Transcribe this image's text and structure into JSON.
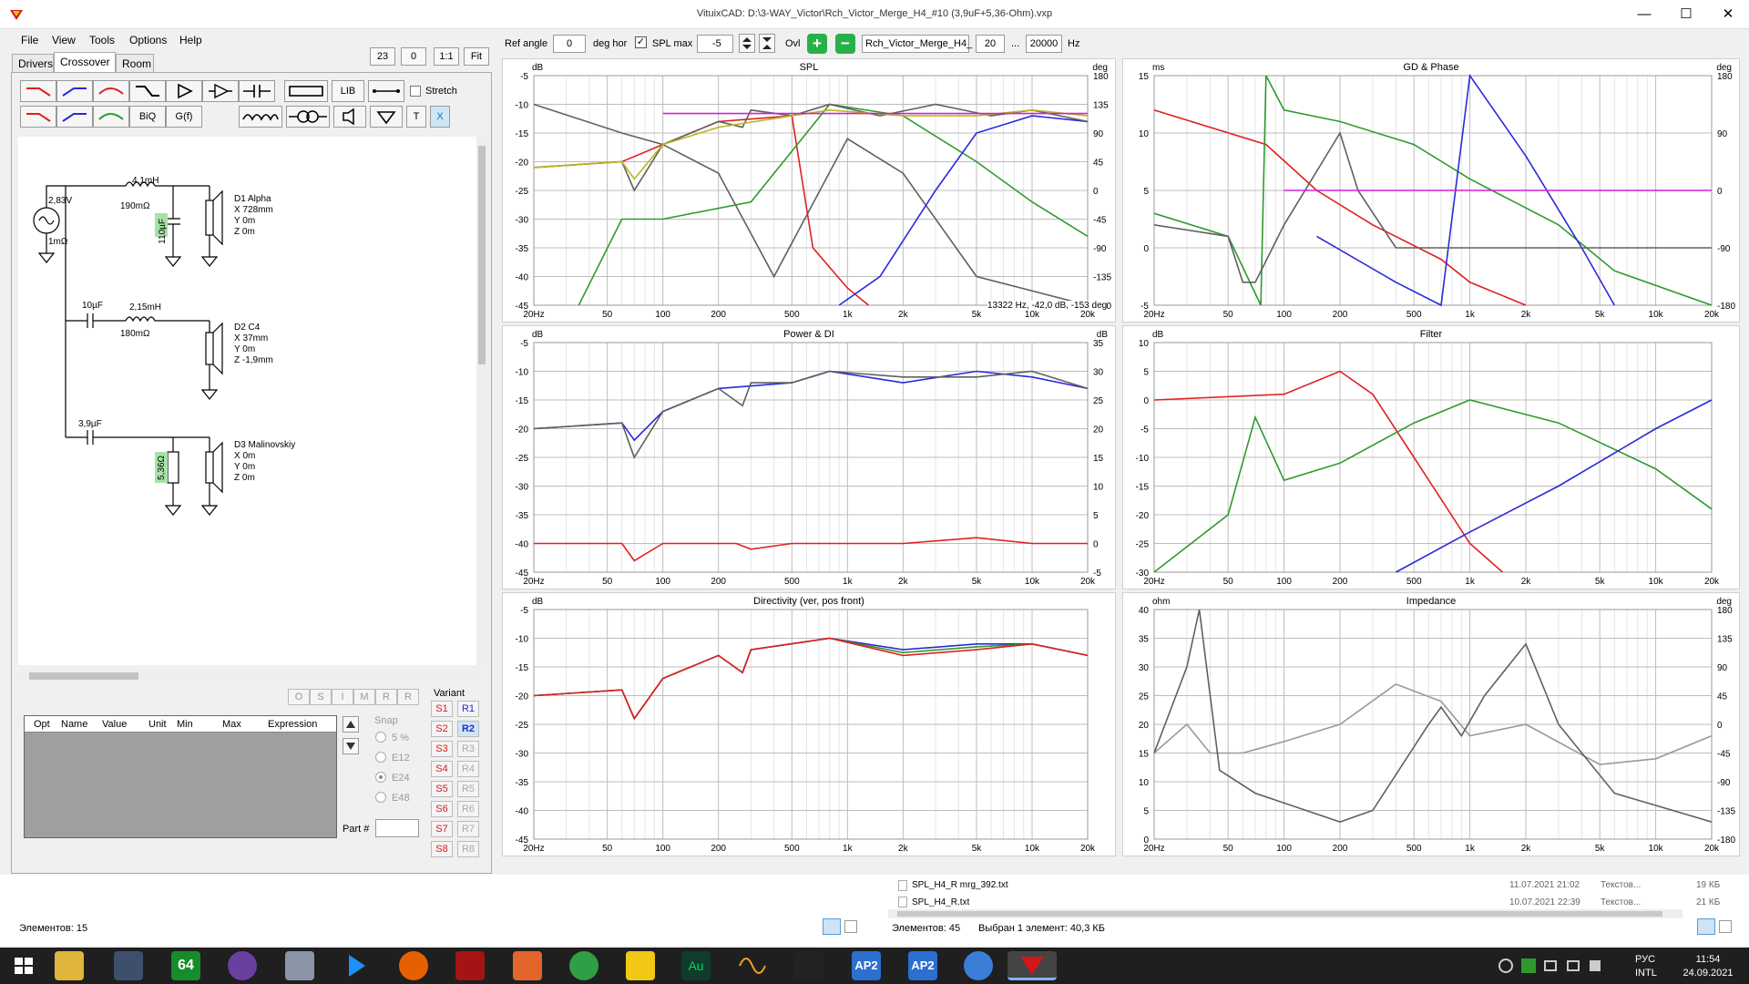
{
  "window": {
    "title": "VituixCAD: D:\\3-WAY_Victor\\Rch_Victor_Merge_H4_#10 (3,9uF+5,36-Ohm).vxp",
    "minimize": "—",
    "maximize": "☐",
    "close": "✕"
  },
  "menu": [
    "File",
    "View",
    "Tools",
    "Options",
    "Help"
  ],
  "tabs": [
    "Drivers",
    "Crossover",
    "Room"
  ],
  "zoom": {
    "a": "23",
    "b": "0",
    "c": "1:1",
    "d": "Fit"
  },
  "toolbar": {
    "lib": "LIB",
    "biq": "BiQ",
    "gf": "G(f)",
    "stretch": "Stretch",
    "t": "T",
    "x": "X"
  },
  "chart_toolbar": {
    "ref_angle_label": "Ref angle",
    "ref_angle_value": "0",
    "deg_hor": "deg hor",
    "spl_max_label": "SPL max",
    "spl_max_value": "-5",
    "ovl": "Ovl",
    "overlay_name": "Rch_Victor_Merge_H4_",
    "range_from": "20",
    "dots": "...",
    "range_to": "20000",
    "hz": "Hz"
  },
  "schematic": {
    "source_v": "2,83V",
    "source_r": "1mΩ",
    "l1": "4,1mH",
    "l1r": "190mΩ",
    "c1": "110µF",
    "d1": [
      "D1 Alpha",
      "X 728mm",
      "Y 0m",
      "Z 0m"
    ],
    "c2": "10µF",
    "l2": "2,15mH",
    "l2r": "180mΩ",
    "d2": [
      "D2 C4",
      "X 37mm",
      "Y 0m",
      "Z -1,9mm"
    ],
    "c3": "3,9µF",
    "r3": "5,36Ω",
    "d3": [
      "D3 Malinovskiy",
      "X 0m",
      "Y 0m",
      "Z 0m"
    ]
  },
  "part_table": {
    "headers": [
      "Opt",
      "Name",
      "Value",
      "Unit",
      "Min",
      "Max",
      "Expression"
    ],
    "osim": [
      "O",
      "S",
      "I",
      "M",
      "R",
      "R"
    ],
    "snap_label": "Snap",
    "snap_options": [
      "5 %",
      "E12",
      "E24",
      "E48"
    ],
    "snap_selected": "E24",
    "part_label": "Part #"
  },
  "variant": {
    "label": "Variant",
    "s": [
      "S1",
      "S2",
      "S3",
      "S4",
      "S5",
      "S6",
      "S7",
      "S8"
    ],
    "r": [
      "R1",
      "R2",
      "R3",
      "R4",
      "R5",
      "R6",
      "R7",
      "R8"
    ],
    "active_s": [
      "S1",
      "S2",
      "S3",
      "S4",
      "S5",
      "S6",
      "S7",
      "S8"
    ],
    "active_r": [
      "R1",
      "R2"
    ]
  },
  "charts": {
    "spl": {
      "title": "SPL",
      "ul": "dB",
      "ur": "deg",
      "readout": "13322 Hz, -42,0 dB, -153 deg"
    },
    "gd": {
      "title": "GD & Phase",
      "ul": "ms",
      "ur": "deg"
    },
    "power": {
      "title": "Power & DI",
      "ul": "dB",
      "ur": "dB"
    },
    "filter": {
      "title": "Filter",
      "ul": "dB",
      "ur": ""
    },
    "dir": {
      "title": "Directivity (ver, pos front)",
      "ul": "dB",
      "ur": ""
    },
    "imp": {
      "title": "Impedance",
      "ul": "ohm",
      "ur": "deg"
    }
  },
  "chart_data": [
    {
      "type": "line",
      "title": "SPL",
      "ylim": [
        -45,
        -5
      ],
      "y2lim": [
        -180,
        180
      ],
      "xlim": [
        20,
        20000
      ],
      "xscale": "log",
      "xticks": [
        "20Hz",
        "50",
        "100",
        "200",
        "500",
        "1k",
        "2k",
        "5k",
        "10k",
        "20k"
      ],
      "yticks": [
        "-5",
        "-10",
        "-15",
        "-20",
        "-25",
        "-30",
        "-35",
        "-40",
        "-45"
      ],
      "y2ticks": [
        "180",
        "135",
        "90",
        "45",
        "0",
        "-45",
        "-90",
        "-135",
        "-180"
      ]
    },
    {
      "type": "line",
      "title": "GD & Phase",
      "ylim": [
        -5,
        15
      ],
      "y2lim": [
        -180,
        180
      ],
      "xlim": [
        20,
        20000
      ],
      "xscale": "log",
      "xticks": [
        "20Hz",
        "50",
        "100",
        "200",
        "500",
        "1k",
        "2k",
        "5k",
        "10k",
        "20k"
      ],
      "yticks": [
        "15",
        "10",
        "5",
        "0",
        "-5"
      ],
      "y2ticks": [
        "180",
        "90",
        "0",
        "-90",
        "-180"
      ]
    },
    {
      "type": "line",
      "title": "Power & DI",
      "ylim": [
        -45,
        -5
      ],
      "y2lim": [
        -5,
        35
      ],
      "xlim": [
        20,
        20000
      ],
      "xscale": "log",
      "xticks": [
        "20Hz",
        "50",
        "100",
        "200",
        "500",
        "1k",
        "2k",
        "5k",
        "10k",
        "20k"
      ],
      "yticks": [
        "-5",
        "-10",
        "-15",
        "-20",
        "-25",
        "-30",
        "-35",
        "-40",
        "-45"
      ],
      "y2ticks": [
        "35",
        "30",
        "25",
        "20",
        "15",
        "10",
        "5",
        "0",
        "-5"
      ]
    },
    {
      "type": "line",
      "title": "Filter",
      "ylim": [
        -30,
        10
      ],
      "xlim": [
        20,
        20000
      ],
      "xscale": "log",
      "xticks": [
        "20Hz",
        "50",
        "100",
        "200",
        "500",
        "1k",
        "2k",
        "5k",
        "10k",
        "20k"
      ],
      "yticks": [
        "10",
        "5",
        "0",
        "-5",
        "-10",
        "-15",
        "-20",
        "-25",
        "-30"
      ]
    },
    {
      "type": "line",
      "title": "Directivity (ver, pos front)",
      "ylim": [
        -45,
        -5
      ],
      "xlim": [
        20,
        20000
      ],
      "xscale": "log",
      "xticks": [
        "20Hz",
        "50",
        "100",
        "200",
        "500",
        "1k",
        "2k",
        "5k",
        "10k",
        "20k"
      ],
      "yticks": [
        "-5",
        "-10",
        "-15",
        "-20",
        "-25",
        "-30",
        "-35",
        "-40",
        "-45"
      ]
    },
    {
      "type": "line",
      "title": "Impedance",
      "ylim": [
        0,
        40
      ],
      "y2lim": [
        -180,
        180
      ],
      "xlim": [
        20,
        20000
      ],
      "xscale": "log",
      "xticks": [
        "20Hz",
        "50",
        "100",
        "200",
        "500",
        "1k",
        "2k",
        "5k",
        "10k",
        "20k"
      ],
      "yticks": [
        "40",
        "35",
        "30",
        "25",
        "20",
        "15",
        "10",
        "5",
        "0"
      ],
      "y2ticks": [
        "180",
        "135",
        "90",
        "45",
        "0",
        "-45",
        "-90",
        "-135",
        "-180"
      ]
    }
  ],
  "statusbar": {
    "left_count": "Элементов: 15",
    "right_count": "Элементов: 45",
    "selected": "Выбран 1 элемент: 40,3 КБ",
    "files": [
      {
        "name": "SPL_H4_R mrg_392.txt",
        "date": "11.07.2021 21:02",
        "type": "Текстов...",
        "size": "19 КБ"
      },
      {
        "name": "SPL_H4_R.txt",
        "date": "10.07.2021 22:39",
        "type": "Текстов...",
        "size": "21 КБ"
      }
    ]
  },
  "taskbar": {
    "lang": "РУС",
    "lang2": "INTL",
    "time": "11:54",
    "date": "24.09.2021",
    "icon64": "64",
    "iconAu": "Au",
    "iconAP2a": "AP2",
    "iconAP2b": "AP2"
  },
  "colors": {
    "red": "#e02020",
    "blue": "#2a2ad8",
    "green": "#2e9a2e",
    "gray": "#606060",
    "magenta": "#d020d0"
  }
}
